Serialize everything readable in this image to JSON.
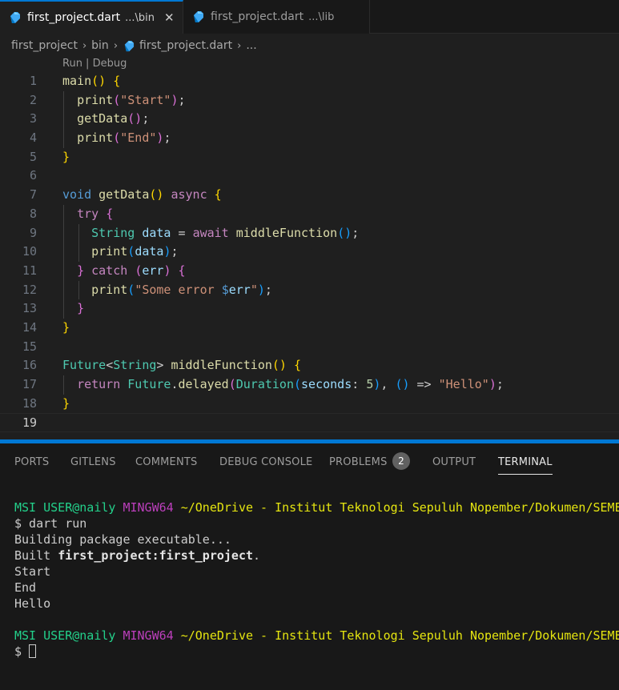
{
  "tabs": [
    {
      "name": "first_project.dart",
      "dir": "...\\bin",
      "close": "✕"
    },
    {
      "name": "first_project.dart",
      "dir": "...\\lib"
    }
  ],
  "breadcrumb": [
    "first_project",
    "bin",
    "first_project.dart",
    "..."
  ],
  "codelens": "Run | Debug",
  "line_numbers": [
    "1",
    "2",
    "3",
    "4",
    "5",
    "6",
    "7",
    "8",
    "9",
    "10",
    "11",
    "12",
    "13",
    "14",
    "15",
    "16",
    "17",
    "18",
    "19"
  ],
  "code": {
    "l1": {
      "fn": "main",
      "paren": "()",
      "brace": "{"
    },
    "l2": {
      "fn": "print",
      "open": "(",
      "str": "\"Start\"",
      "close": ")",
      "semi": ";"
    },
    "l3": {
      "fn": "getData",
      "paren": "()",
      "semi": ";"
    },
    "l4": {
      "fn": "print",
      "open": "(",
      "str": "\"End\"",
      "close": ")",
      "semi": ";"
    },
    "l5": {
      "brace": "}"
    },
    "l7": {
      "kw": "void",
      "fn": "getData",
      "paren": "()",
      "async": "async",
      "brace": "{"
    },
    "l8": {
      "kw": "try",
      "brace": "{"
    },
    "l9": {
      "type": "String",
      "var": "data",
      "eq": "=",
      "await": "await",
      "fn": "middleFunction",
      "paren": "()",
      "semi": ";"
    },
    "l10": {
      "fn": "print",
      "open": "(",
      "var": "data",
      "close": ")",
      "semi": ";"
    },
    "l11": {
      "close_brace": "}",
      "kw": "catch",
      "open": "(",
      "var": "err",
      "close": ")",
      "brace": "{"
    },
    "l12": {
      "fn": "print",
      "open": "(",
      "str": "\"Some error ",
      "dollar": "$",
      "interp": "err",
      "str_end": "\"",
      "close": ")",
      "semi": ";"
    },
    "l13": {
      "brace": "}"
    },
    "l14": {
      "brace": "}"
    },
    "l16": {
      "type": "Future",
      "lt": "<",
      "type2": "String",
      "gt": ">",
      "fn": "middleFunction",
      "paren": "()",
      "brace": "{"
    },
    "l17": {
      "kw": "return",
      "type": "Future",
      "dot": ".",
      "fn": "delayed",
      "open": "(",
      "type2": "Duration",
      "open2": "(",
      "param": "seconds",
      "colon": ":",
      "num": "5",
      "close2": ")",
      "comma": ",",
      "lambda": "()",
      "arrow": "=>",
      "str": "\"Hello\"",
      "close": ")",
      "semi": ";"
    },
    "l18": {
      "brace": "}"
    }
  },
  "panel": {
    "tabs": [
      "PORTS",
      "GITLENS",
      "COMMENTS",
      "DEBUG CONSOLE",
      "PROBLEMS",
      "OUTPUT",
      "TERMINAL"
    ],
    "problems_count": "2",
    "active_tab": "TERMINAL"
  },
  "terminal": {
    "prompt_user": "MSI USER@naily",
    "prompt_env": "MINGW64",
    "prompt_path": "~/OneDrive - Institut Teknologi Sepuluh Nopember/Dokumen/SEMESTER",
    "cmd": "$ dart run",
    "out1": "Building package executable...",
    "out2_pre": "Built ",
    "out2_bold": "first_project:first_project",
    "out2_post": ".",
    "out3": "Start",
    "out4": "End",
    "out5": "Hello",
    "prompt2_user": "MSI USER@naily",
    "prompt2_env": "MINGW64",
    "prompt2_path": "~/OneDrive - Institut Teknologi Sepuluh Nopember/Dokumen/SEMESTER",
    "dollar": "$"
  },
  "colors": {
    "accent": "#0078d4",
    "background": "#1f1f1f",
    "panel": "#181818"
  }
}
